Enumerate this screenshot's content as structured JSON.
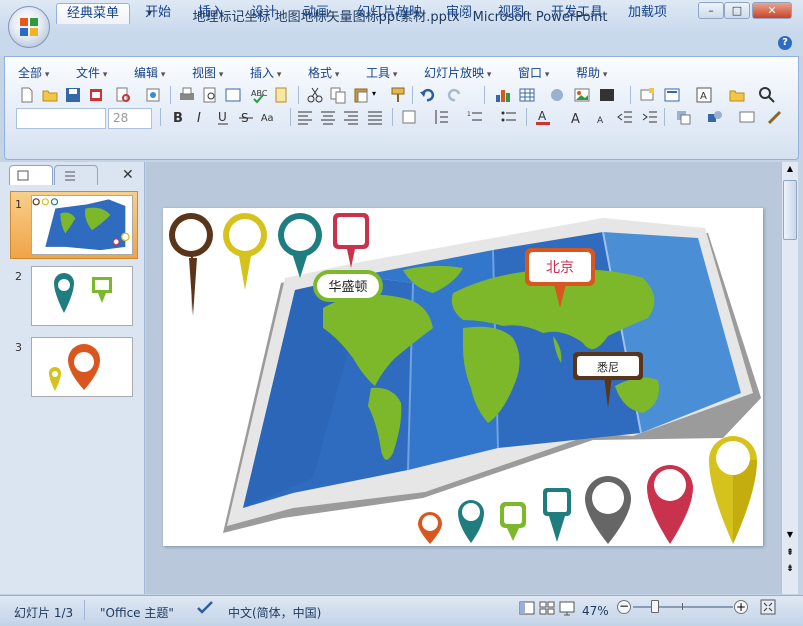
{
  "window": {
    "title": "地理标记坐标 地图地标矢量图标ppt素材.pptx - Microsoft PowerPoint",
    "min_label": "–",
    "max_label": "□",
    "close_label": "✕"
  },
  "tabs": [
    "经典菜单",
    "开始",
    "插入",
    "设计",
    "动画",
    "幻灯片放映",
    "审阅",
    "视图",
    "开发工具",
    "加载项"
  ],
  "help_label": "?",
  "menus": [
    "全部",
    "文件",
    "编辑",
    "视图",
    "插入",
    "格式",
    "工具",
    "幻灯片放映",
    "窗口",
    "帮助"
  ],
  "font_size": "28",
  "panel": {
    "close_label": "✕",
    "slide_numbers": [
      "1",
      "2",
      "3"
    ]
  },
  "slide": {
    "labels": {
      "washington": "华盛顿",
      "beijing": "北京",
      "sydney": "悉尼"
    }
  },
  "status": {
    "slide_info": "幻灯片 1/3",
    "theme": "\"Office 主题\"",
    "language": "中文(简体，中国)",
    "zoom": "47%"
  },
  "colors": {
    "ribbon_text": "#15428b",
    "map_blue": "#2f6cc0",
    "land_green": "#7cb82a",
    "pin_brown": "#5a3519",
    "pin_yellow": "#d6c21d",
    "pin_teal": "#1f7d80",
    "pin_crimson": "#c8324c",
    "pin_orange": "#d9571e",
    "pin_gray": "#666666"
  }
}
